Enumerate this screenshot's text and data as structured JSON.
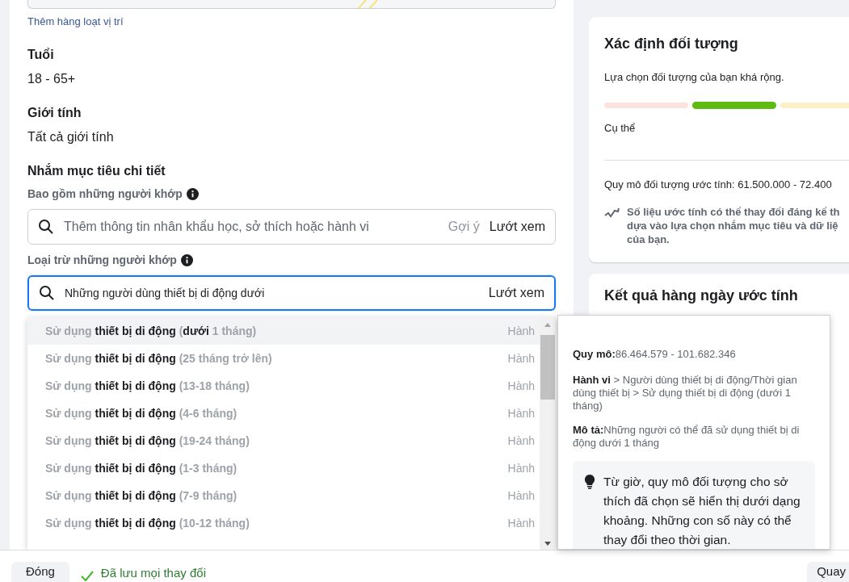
{
  "location": {
    "bulk_link": "Thêm hàng loạt vị trí"
  },
  "age": {
    "label": "Tuổi",
    "value": "18 - 65+"
  },
  "gender": {
    "label": "Giới tính",
    "value": "Tất cả giới tính"
  },
  "detailed_targeting": {
    "title": "Nhắm mục tiêu chi tiết",
    "include": {
      "label": "Bao gồm những người khớp",
      "placeholder": "Thêm thông tin nhân khẩu học, sở thích hoặc hành vi",
      "suggest": "Gợi ý",
      "browse": "Lướt xem",
      "focused": false
    },
    "exclude": {
      "label": "Loại trừ những người khớp",
      "value": "Những người dùng thiết bị di động dưới",
      "browse": "Lướt xem",
      "focused": true
    }
  },
  "dropdown": {
    "items": [
      {
        "text": "Sử dụng **thiết bị di động** (**dưới** 1 tháng)",
        "category": "Hành",
        "selected": true
      },
      {
        "text": "Sử dụng **thiết bị di động** (25 tháng trở lên)",
        "category": "Hành",
        "selected": false
      },
      {
        "text": "Sử dụng **thiết bị di động** (13-18 tháng)",
        "category": "Hành",
        "selected": false
      },
      {
        "text": "Sử dụng **thiết bị di động** (4-6 tháng)",
        "category": "Hành",
        "selected": false
      },
      {
        "text": "Sử dụng **thiết bị di động** (19-24 tháng)",
        "category": "Hành",
        "selected": false
      },
      {
        "text": "Sử dụng **thiết bị di động** (1-3 tháng)",
        "category": "Hành",
        "selected": false
      },
      {
        "text": "Sử dụng **thiết bị di động** (7-9 tháng)",
        "category": "Hành",
        "selected": false
      },
      {
        "text": "Sử dụng **thiết bị di động** (10-12 tháng)",
        "category": "Hành",
        "selected": false
      }
    ]
  },
  "tooltip": {
    "size": "**Quy mô:**86.464.579 - 101.682.346",
    "path": "**Hành vi** > Người dùng thiết bị di động/Thời gian dùng thiết bị > Sử dụng thiết bị di động (dưới 1 tháng)",
    "description": "**Mô tả:**Những người có thể đã sử dụng thiết bị di động dưới 1 tháng",
    "notice": "Từ giờ, quy mô đối tượng cho sở thích đã chọn sẽ hiển thị dưới dạng khoảng. Những con số này có thể thay đổi theo thời gian."
  },
  "audience_card": {
    "title": "Xác định đối tượng",
    "subtitle": "Lựa chọn đối tượng của bạn khá rộng.",
    "meter": [
      {
        "color": "#fce3df",
        "selected": false
      },
      {
        "color": "#5dbb11",
        "selected": true
      },
      {
        "color": "#fdefc8",
        "selected": false
      }
    ],
    "meter_label": "Cụ thể",
    "estimate": "Quy mô đối tượng ước tính: 61.500.000 - 72.400",
    "note_lines": [
      "Số liệu ước tính có thể thay đổi đáng kể th",
      "dựa vào lựa chọn nhắm mục tiêu và dữ liệ",
      "của bạn."
    ]
  },
  "daily_card": {
    "title": "Kết quả hàng ngày ước tính"
  },
  "footer": {
    "close": "Đóng",
    "saved": "Đã lưu mọi thay đổi",
    "back": "Quay"
  }
}
